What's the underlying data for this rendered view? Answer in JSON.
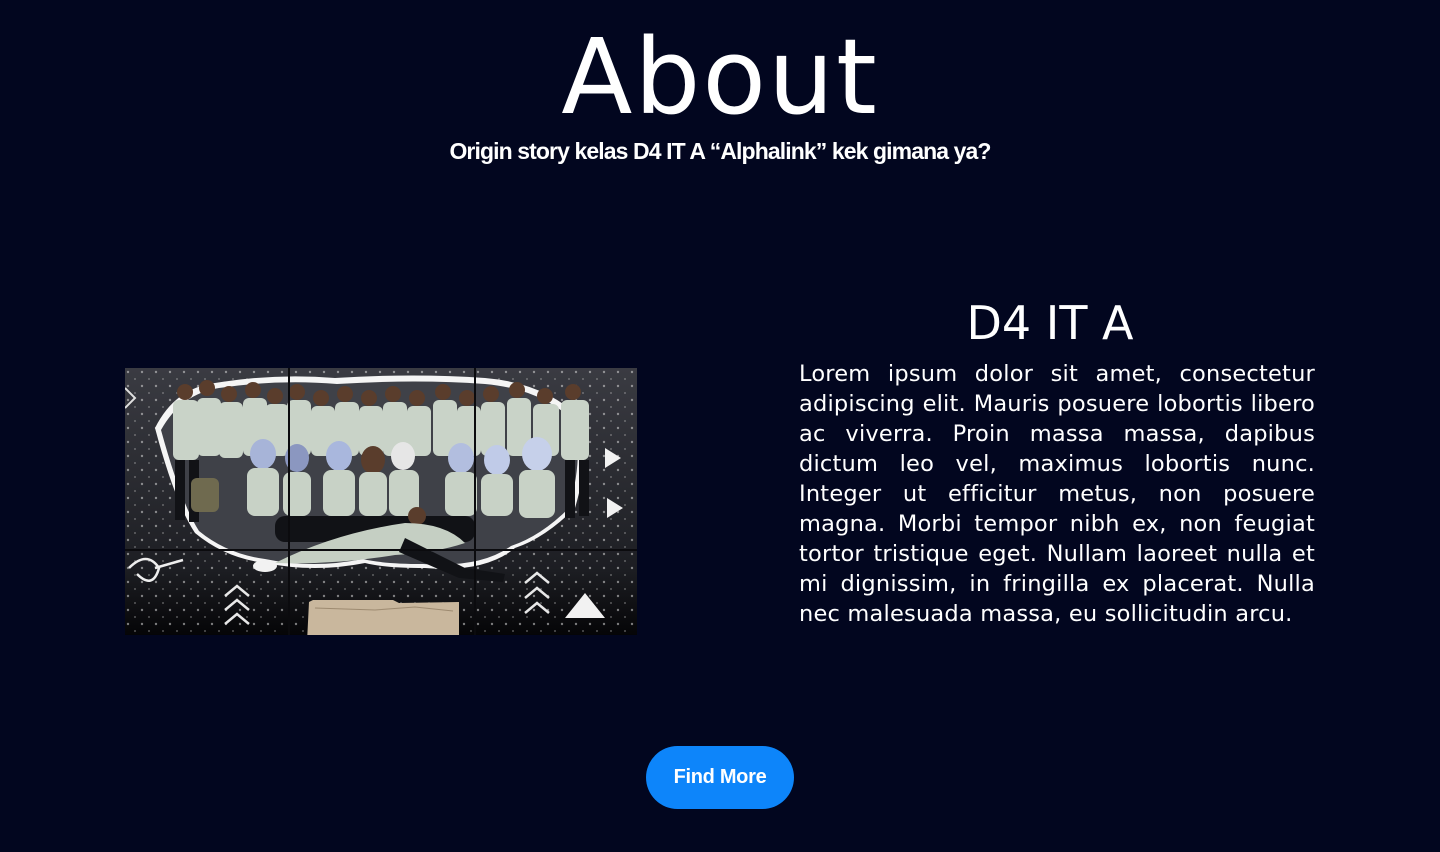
{
  "header": {
    "title": "About",
    "subtitle": "Origin story kelas D4 IT A “Alphalink” kek gimana ya?"
  },
  "photo": {
    "caption_label": "D4 IT A"
  },
  "section": {
    "heading": "D4 IT A",
    "body": "Lorem ipsum dolor sit amet, consectetur adipiscing elit. Mauris posuere lobortis libero ac viverra. Proin massa massa, dapibus dictum leo vel, maximus lobortis nunc. Integer ut efficitur metus, non posuere magna. Morbi tempor nibh ex, non feugiat tortor tristique eget. Nullam laoreet nulla et mi dignissim, in fringilla ex placerat. Nulla nec malesuada massa, eu sollicitudin arcu."
  },
  "cta": {
    "label": "Find More"
  },
  "colors": {
    "background": "#02061f",
    "text": "#ffffff",
    "button": "#0d85fa"
  }
}
